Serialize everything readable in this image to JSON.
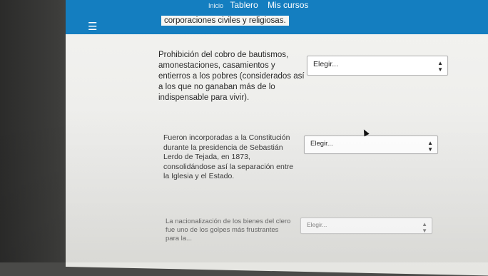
{
  "nav": {
    "inicio": "Inicio",
    "tablero": "Tablero",
    "mis_cursos": "Mis cursos"
  },
  "top_fragment": "corporaciones civiles y religiosas.",
  "questions": [
    {
      "text": "Prohibición del cobro de bautismos, amonestaciones, casamientos y entierros a los pobres (considerados así a los que no ganaban más de lo indispensable para vivir).",
      "select": "Elegir..."
    },
    {
      "text": "Fueron incorporadas a la Constitución durante la presidencia de Sebastián Lerdo de Tejada, en 1873, consolidándose así la separación entre la Iglesia y el Estado.",
      "select": "Elegir..."
    },
    {
      "text": "La nacionalización de los bienes del clero fue uno de los golpes más frustrantes para la...",
      "select": "Elegir..."
    }
  ],
  "colors": {
    "header": "#147ec0",
    "page": "#f3f3f0"
  },
  "icons": [
    "menu-icon",
    "select-arrow-icon",
    "mouse-cursor-icon"
  ]
}
